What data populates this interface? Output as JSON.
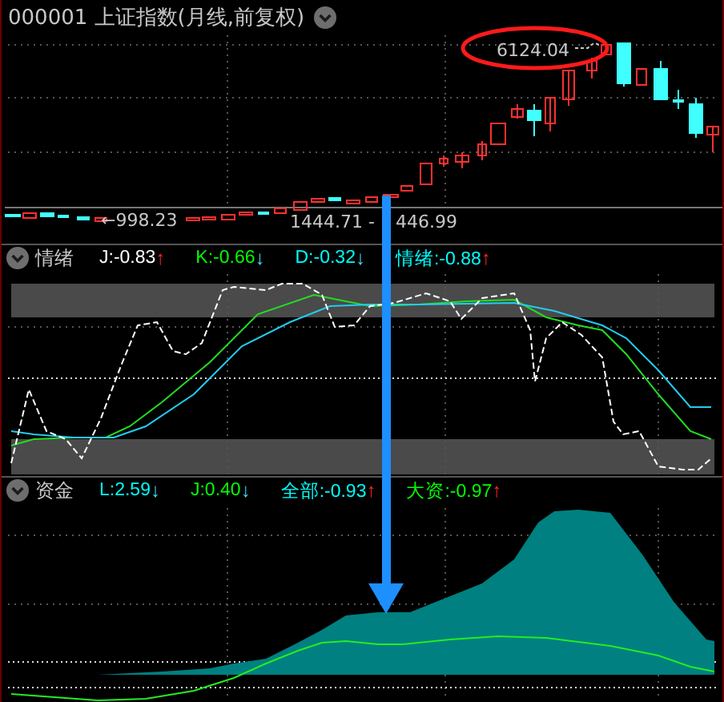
{
  "title": "000001 上证指数(月线,前复权)",
  "price_panel": {
    "labels": [
      {
        "kind": "low",
        "text": "←998.23"
      },
      {
        "kind": "range_low",
        "text": "1444.71 -"
      },
      {
        "kind": "range_high",
        "text": "446.99"
      },
      {
        "kind": "high",
        "text": "6124.04",
        "circled": true
      }
    ]
  },
  "indicator_panels": [
    {
      "name": "情绪",
      "kind": "lines",
      "values": [
        {
          "text": "J:-0.83",
          "color": "#ffffff",
          "arrow": "↑",
          "kind": "rising"
        },
        {
          "text": "K:-0.66",
          "color": "#00ff00",
          "arrow": "↓",
          "kind": "falling"
        },
        {
          "text": "D:-0.32",
          "color": "#00ffff",
          "arrow": "↓",
          "kind": "falling"
        },
        {
          "text": "情绪:-0.88",
          "color": "#00ffff",
          "arrow": "↑",
          "kind": "rising"
        }
      ]
    },
    {
      "name": "资金",
      "kind": "area",
      "values": [
        {
          "text": "L:2.59",
          "color": "#00ffff",
          "arrow": "↓",
          "kind": "falling"
        },
        {
          "text": "J:0.40",
          "color": "#00ff00",
          "arrow": "↓",
          "kind": "falling"
        },
        {
          "text": "全部:-0.93",
          "color": "#00ffff",
          "arrow": "↑",
          "kind": "rising"
        },
        {
          "text": "大资:-0.97",
          "color": "#00ff00",
          "arrow": "↑",
          "kind": "rising"
        }
      ]
    }
  ]
}
